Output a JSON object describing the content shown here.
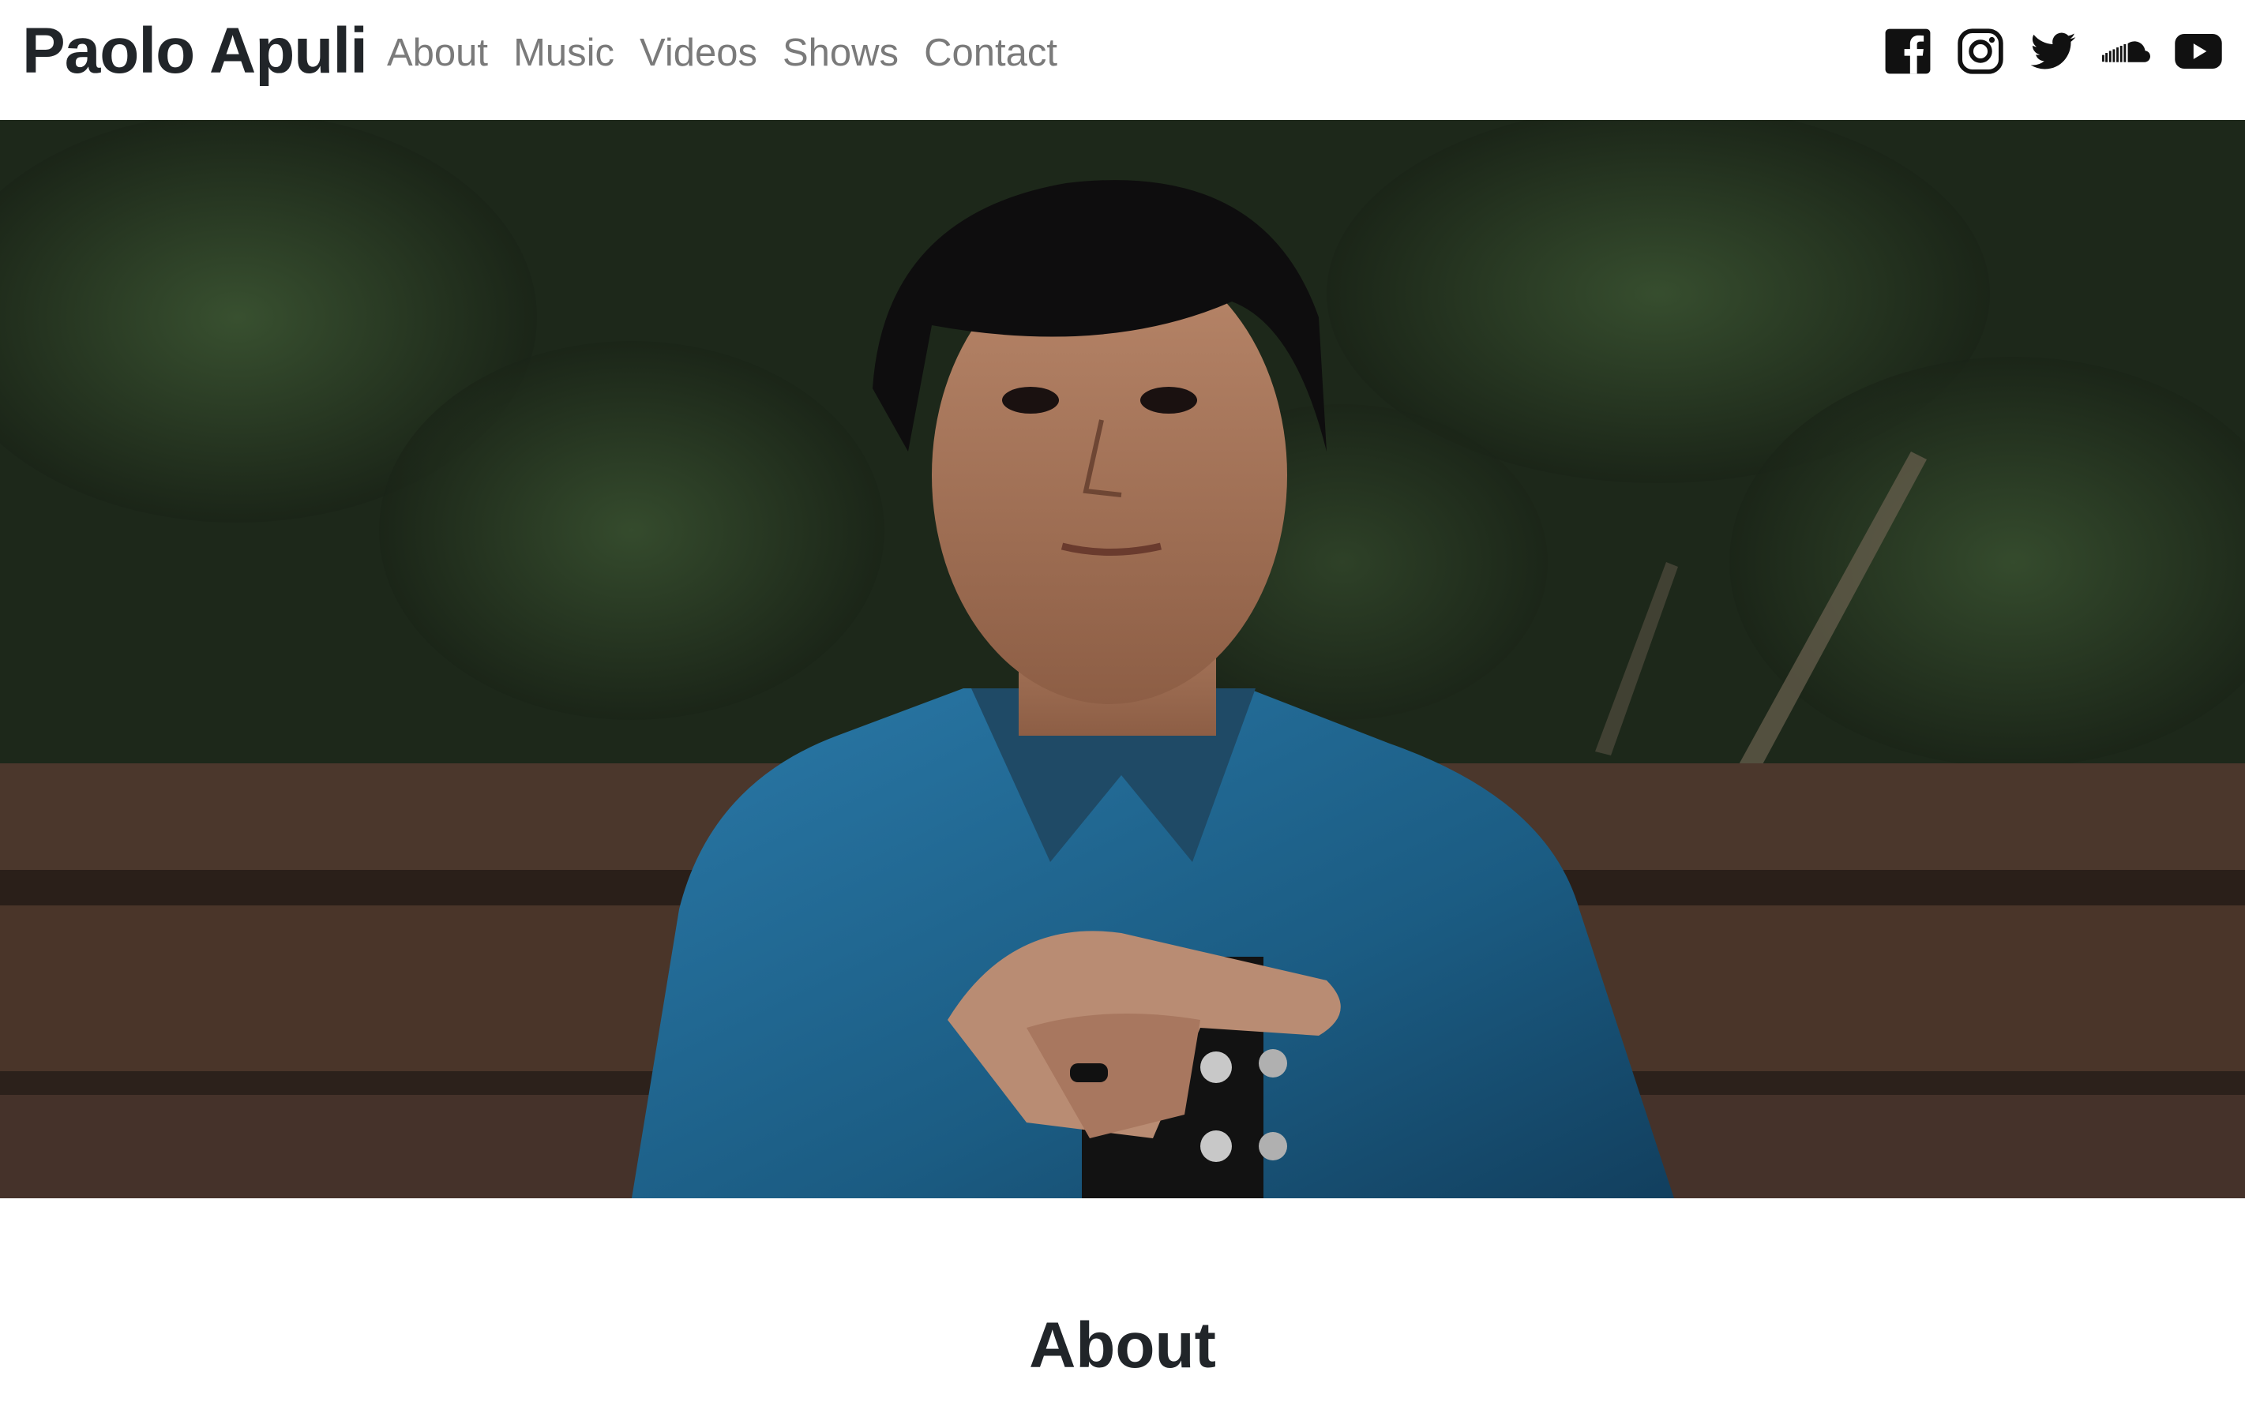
{
  "navbar": {
    "brand": "Paolo Apuli",
    "links": [
      {
        "label": "About"
      },
      {
        "label": "Music"
      },
      {
        "label": "Videos"
      },
      {
        "label": "Shows"
      },
      {
        "label": "Contact"
      }
    ],
    "social": [
      {
        "icon": "facebook-icon"
      },
      {
        "icon": "instagram-icon"
      },
      {
        "icon": "twitter-icon"
      },
      {
        "icon": "soundcloud-icon"
      },
      {
        "icon": "youtube-icon"
      }
    ]
  },
  "hero": {
    "image": "portrait-photo",
    "colors": {
      "foliage": "#1f2a1c",
      "bench": "#4a352b",
      "shirt": "#1e5f86"
    }
  },
  "about": {
    "title": "About"
  },
  "colors": {
    "brand_text": "#212529",
    "nav_text": "#7a7a7a",
    "icon": "#111111"
  }
}
